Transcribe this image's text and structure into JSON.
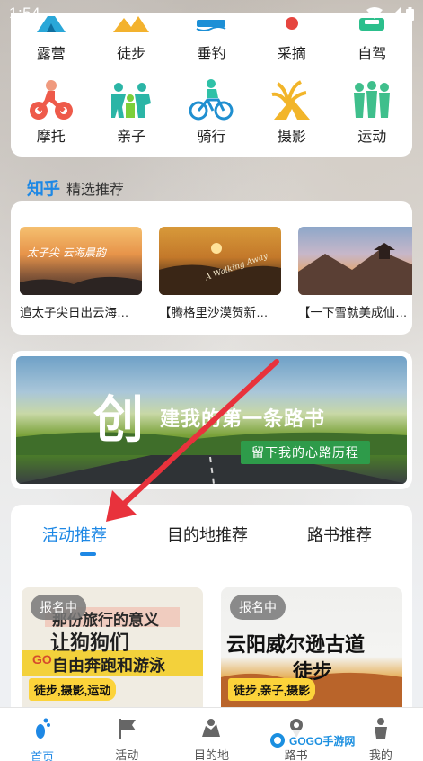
{
  "status_bar": {
    "time": "1:54"
  },
  "categories": {
    "row1": [
      {
        "label": "露营",
        "icon": "tent-icon"
      },
      {
        "label": "徒步",
        "icon": "hiking-icon"
      },
      {
        "label": "垂钓",
        "icon": "fishing-icon"
      },
      {
        "label": "采摘",
        "icon": "picking-icon"
      },
      {
        "label": "自驾",
        "icon": "car-icon"
      }
    ],
    "row2": [
      {
        "label": "摩托",
        "icon": "motorcycle-icon"
      },
      {
        "label": "亲子",
        "icon": "family-icon"
      },
      {
        "label": "骑行",
        "icon": "cycling-icon"
      },
      {
        "label": "摄影",
        "icon": "photography-icon"
      },
      {
        "label": "运动",
        "icon": "sports-icon"
      }
    ]
  },
  "zhihu": {
    "logo": "知乎",
    "title": "精选推荐",
    "items": [
      {
        "caption": "追太子尖日出云海…",
        "overlay": "太子尖 云海晨韵"
      },
      {
        "caption": "【腾格里沙漠贺新…",
        "overlay": "A Walking Away"
      },
      {
        "caption": "【一下雪就美成仙…",
        "overlay": ""
      }
    ]
  },
  "banner": {
    "big_char": "创",
    "headline": "建我的第一条路书",
    "subline": "留下我的心路历程"
  },
  "tabs": [
    {
      "label": "活动推荐",
      "active": true
    },
    {
      "label": "目的地推荐",
      "active": false
    },
    {
      "label": "路书推荐",
      "active": false
    }
  ],
  "activities": [
    {
      "badge": "报名中",
      "poster_lines": [
        "那份旅行的意义",
        "让狗狗们",
        "自由奔跑和游泳"
      ],
      "brand": "GO",
      "tags": "徒步,摄影,运动"
    },
    {
      "badge": "报名中",
      "poster_lines": [
        "云阳威尔逊古道",
        "徒步"
      ],
      "tags": "徒步,亲子,摄影"
    }
  ],
  "tabbar": [
    {
      "label": "首页",
      "icon": "footprint-icon",
      "active": true
    },
    {
      "label": "活动",
      "icon": "flag-icon",
      "active": false
    },
    {
      "label": "目的地",
      "icon": "map-pin-icon",
      "active": false
    },
    {
      "label": "路书",
      "icon": "route-book-icon",
      "active": false
    },
    {
      "label": "我的",
      "icon": "person-icon",
      "active": false
    }
  ],
  "watermark": {
    "text": "GOGO手游网"
  },
  "colors": {
    "accent": "#1e88e5",
    "tag_yellow": "#fcd33a",
    "arrow_red": "#e8323c"
  }
}
